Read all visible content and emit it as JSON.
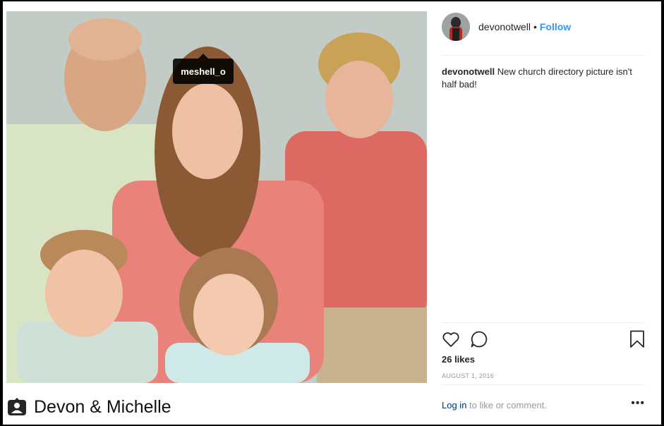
{
  "photo": {
    "tag_username": "meshell_o",
    "caption_title": "Devon & Michelle"
  },
  "post": {
    "username": "devonotwell",
    "separator": "•",
    "follow_label": "Follow",
    "comment_user": "devonotwell",
    "comment_text": "New church directory picture isn't half bad!",
    "likes": "26 likes",
    "date": "AUGUST 1, 2016",
    "login_link": "Log in",
    "login_suffix": "to like or comment.",
    "more_label": "•••"
  },
  "icons": {
    "like": "heart-icon",
    "comment": "comment-bubble-icon",
    "save": "bookmark-icon",
    "tag": "user-tag-icon"
  },
  "colors": {
    "link": "#3897f0",
    "text": "#262626",
    "muted": "#999999"
  }
}
